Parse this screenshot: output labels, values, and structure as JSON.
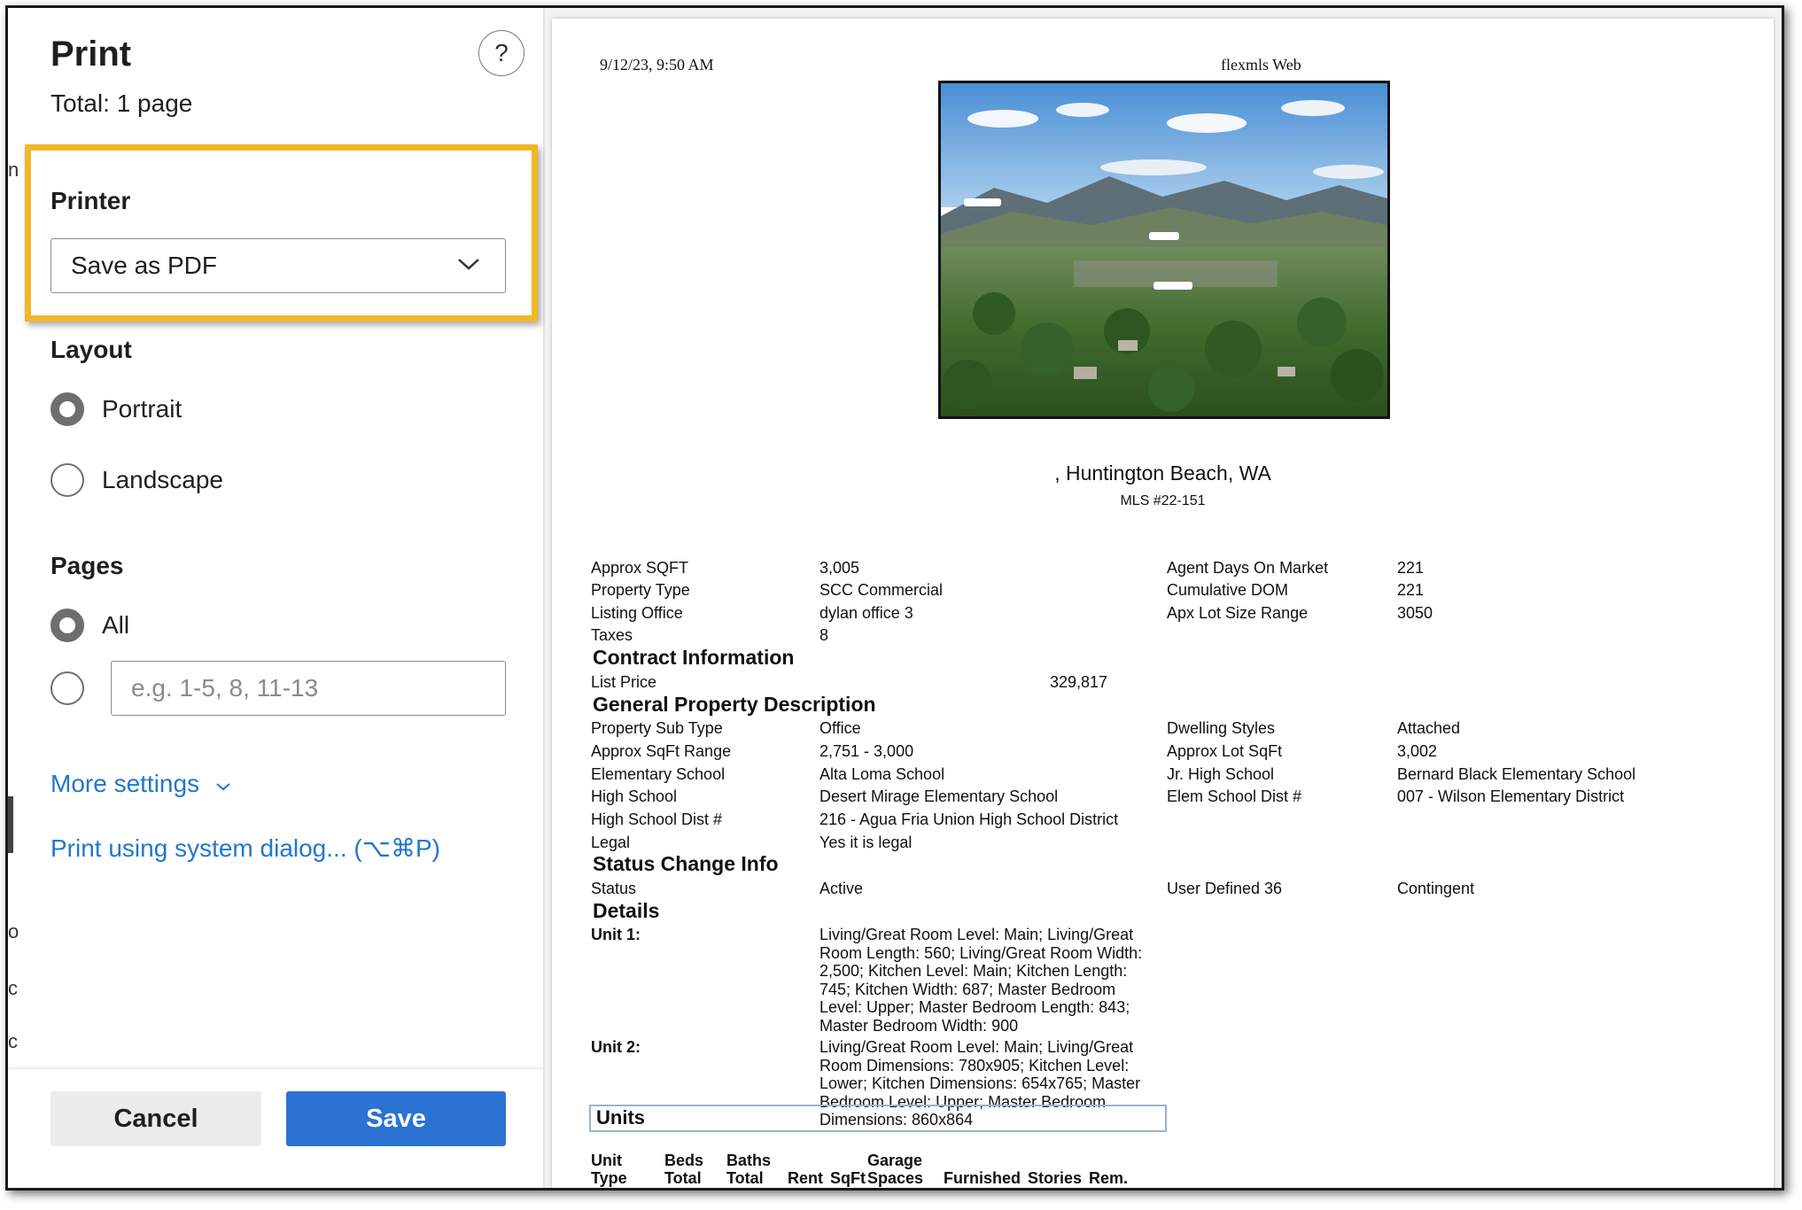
{
  "dialog": {
    "title": "Print",
    "total": "Total: 1 page",
    "help_label": "?",
    "printer_label": "Printer",
    "printer_value": "Save as PDF",
    "layout_label": "Layout",
    "layout_options": [
      "Portrait",
      "Landscape"
    ],
    "layout_selected": "Portrait",
    "pages_label": "Pages",
    "pages_all": "All",
    "pages_placeholder": "e.g. 1-5, 8, 11-13",
    "more_settings": "More settings",
    "system_dialog": "Print using system dialog... (⌥⌘P)",
    "cancel": "Cancel",
    "save": "Save",
    "highlight_color": "#f0b825",
    "accent_color": "#2b73d3",
    "link_color": "#2277cc",
    "edge_fragments": [
      "n",
      "o",
      "c",
      "c"
    ]
  },
  "preview": {
    "date": "9/12/23, 9:50 AM",
    "site": "flexmls Web",
    "address": ", Huntington Beach, WA",
    "mls": "MLS #22-151",
    "photo_labels": [
      "",
      "",
      ""
    ],
    "top_left": [
      {
        "label": "Approx SQFT",
        "value": "3,005"
      },
      {
        "label": "Property Type",
        "value": "SCC Commercial"
      },
      {
        "label": "Listing Office",
        "value": "dylan office 3"
      },
      {
        "label": "Taxes",
        "value": "8"
      }
    ],
    "top_right": [
      {
        "label": "Agent Days On Market",
        "value": "221"
      },
      {
        "label": "Cumulative DOM",
        "value": "221"
      },
      {
        "label": "Apx Lot Size Range",
        "value": "3050"
      }
    ],
    "contract_header": "Contract Information",
    "list_price_label": "List Price",
    "list_price_value": "329,817",
    "general_header": "General Property Description",
    "general_left": [
      {
        "label": "Property Sub Type",
        "value": "Office"
      },
      {
        "label": "Approx SqFt Range",
        "value": "2,751 - 3,000"
      },
      {
        "label": "Elementary School",
        "value": "Alta Loma School"
      },
      {
        "label": "High School",
        "value": "Desert Mirage Elementary School"
      },
      {
        "label": "High School Dist #",
        "value": "216 - Agua Fria Union High School District"
      },
      {
        "label": "Legal",
        "value": "Yes it is legal"
      }
    ],
    "general_right": [
      {
        "label": "Dwelling Styles",
        "value": "Attached"
      },
      {
        "label": "Approx Lot SqFt",
        "value": "3,002"
      },
      {
        "label": "Jr. High School",
        "value": "Bernard Black Elementary School"
      },
      {
        "label": "Elem School Dist #",
        "value": "007 - Wilson Elementary District"
      }
    ],
    "status_header": "Status Change Info",
    "status_label": "Status",
    "status_value": "Active",
    "user_defined_label": "User Defined 36",
    "user_defined_value": "Contingent",
    "details_header": "Details",
    "unit1_label": "Unit 1:",
    "unit1_text": "Living/Great Room Level: Main; Living/Great Room Length: 560; Living/Great Room Width: 2,500; Kitchen Level: Main; Kitchen Length: 745; Kitchen Width: 687; Master Bedroom Level: Upper; Master Bedroom Length: 843; Master Bedroom Width: 900",
    "unit2_label": "Unit 2:",
    "unit2_text": "Living/Great Room Level: Main; Living/Great Room Dimensions: 780x905; Kitchen Level: Lower; Kitchen Dimensions: 654x765; Master Bedroom Level: Upper; Master Bedroom Dimensions: 860x864",
    "units_header": "Units",
    "units_columns": [
      {
        "top": "Unit",
        "bottom": "Type"
      },
      {
        "top": "Beds",
        "bottom": "Total"
      },
      {
        "top": "Baths",
        "bottom": "Total"
      },
      {
        "top": "",
        "bottom": "Rent"
      },
      {
        "top": "",
        "bottom": "SqFt"
      },
      {
        "top": "Garage",
        "bottom": "Spaces"
      },
      {
        "top": "",
        "bottom": "Furnished"
      },
      {
        "top": "",
        "bottom": "Stories"
      },
      {
        "top": "",
        "bottom": "Rem."
      }
    ]
  }
}
